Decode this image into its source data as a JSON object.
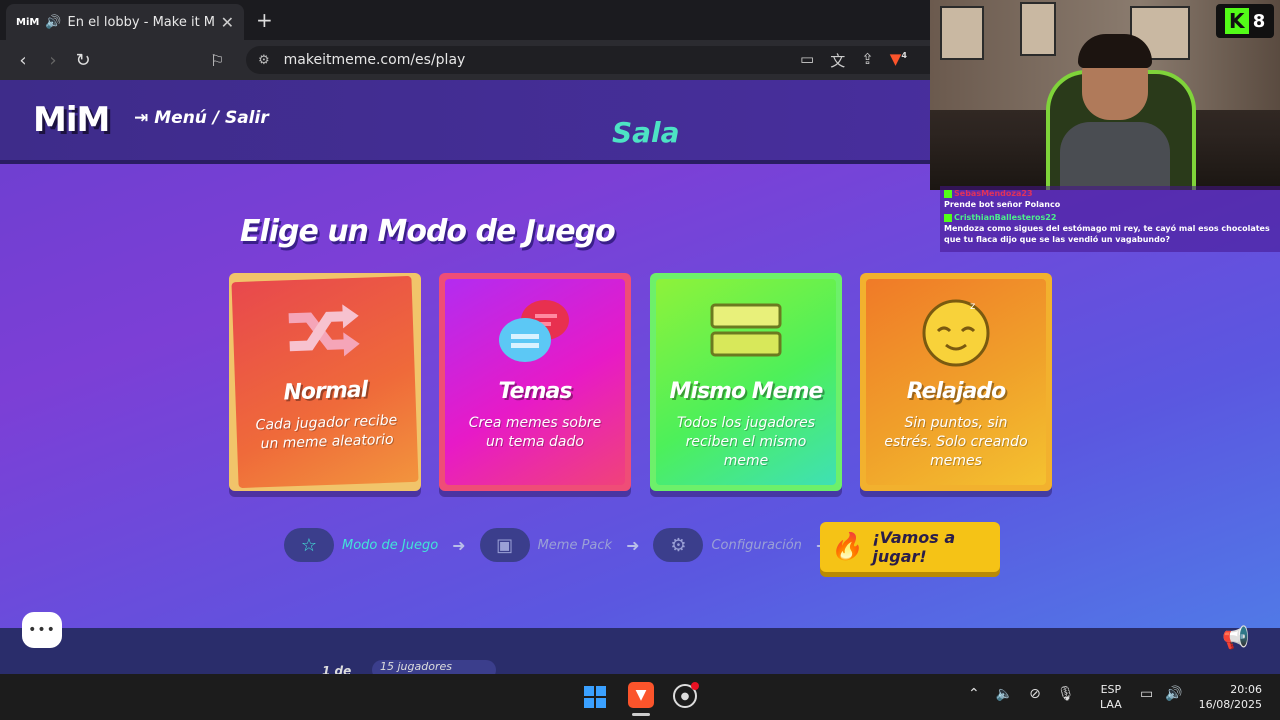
{
  "browser": {
    "tab_favicon": "MiM",
    "tab_audio_icon": "speaker-icon",
    "tab_title": "En el lobby - Make it Meme",
    "new_tab": "+",
    "url": "makeitmeme.com/es/play",
    "brave_shield_count": "4"
  },
  "game": {
    "logo": "MiM",
    "exit_label": "Menú / Salir",
    "room_title": "Sala",
    "heading": "Elige un Modo de Juego",
    "modes": [
      {
        "title": "Normal",
        "desc": "Cada jugador recibe un meme aleatorio",
        "icon": "shuffle-icon"
      },
      {
        "title": "Temas",
        "desc": "Crea memes sobre un tema dado",
        "icon": "chat-bubbles-icon"
      },
      {
        "title": "Mismo Meme",
        "desc": "Todos los jugadores reciben el mismo meme",
        "icon": "stacked-bars-icon"
      },
      {
        "title": "Relajado",
        "desc": "Sin puntos, sin estrés. Solo creando memes",
        "icon": "sleepy-face-icon"
      }
    ],
    "steps": [
      {
        "label": "Modo de Juego",
        "icon": "star-icon"
      },
      {
        "label": "Meme Pack",
        "icon": "box-icon"
      },
      {
        "label": "Configuración",
        "icon": "gear-icon"
      }
    ],
    "play_button": "¡Vamos a jugar!",
    "player_count_fragment": "1 de",
    "players_fragment": "15 jugadores"
  },
  "stream": {
    "viewer_count": "8",
    "chat": [
      {
        "user": "SebasMendoza23",
        "message": "Prende bot señor Polanco"
      },
      {
        "user": "CristhianBallesteros22",
        "message": "Mendoza como sigues del estómago mi rey, te cayó mal esos chocolates que tu flaca dijo que se las vendió un vagabundo?"
      }
    ]
  },
  "taskbar": {
    "lang_top": "ESP",
    "lang_bottom": "LAA",
    "time": "20:06",
    "date": "16/08/2025"
  }
}
